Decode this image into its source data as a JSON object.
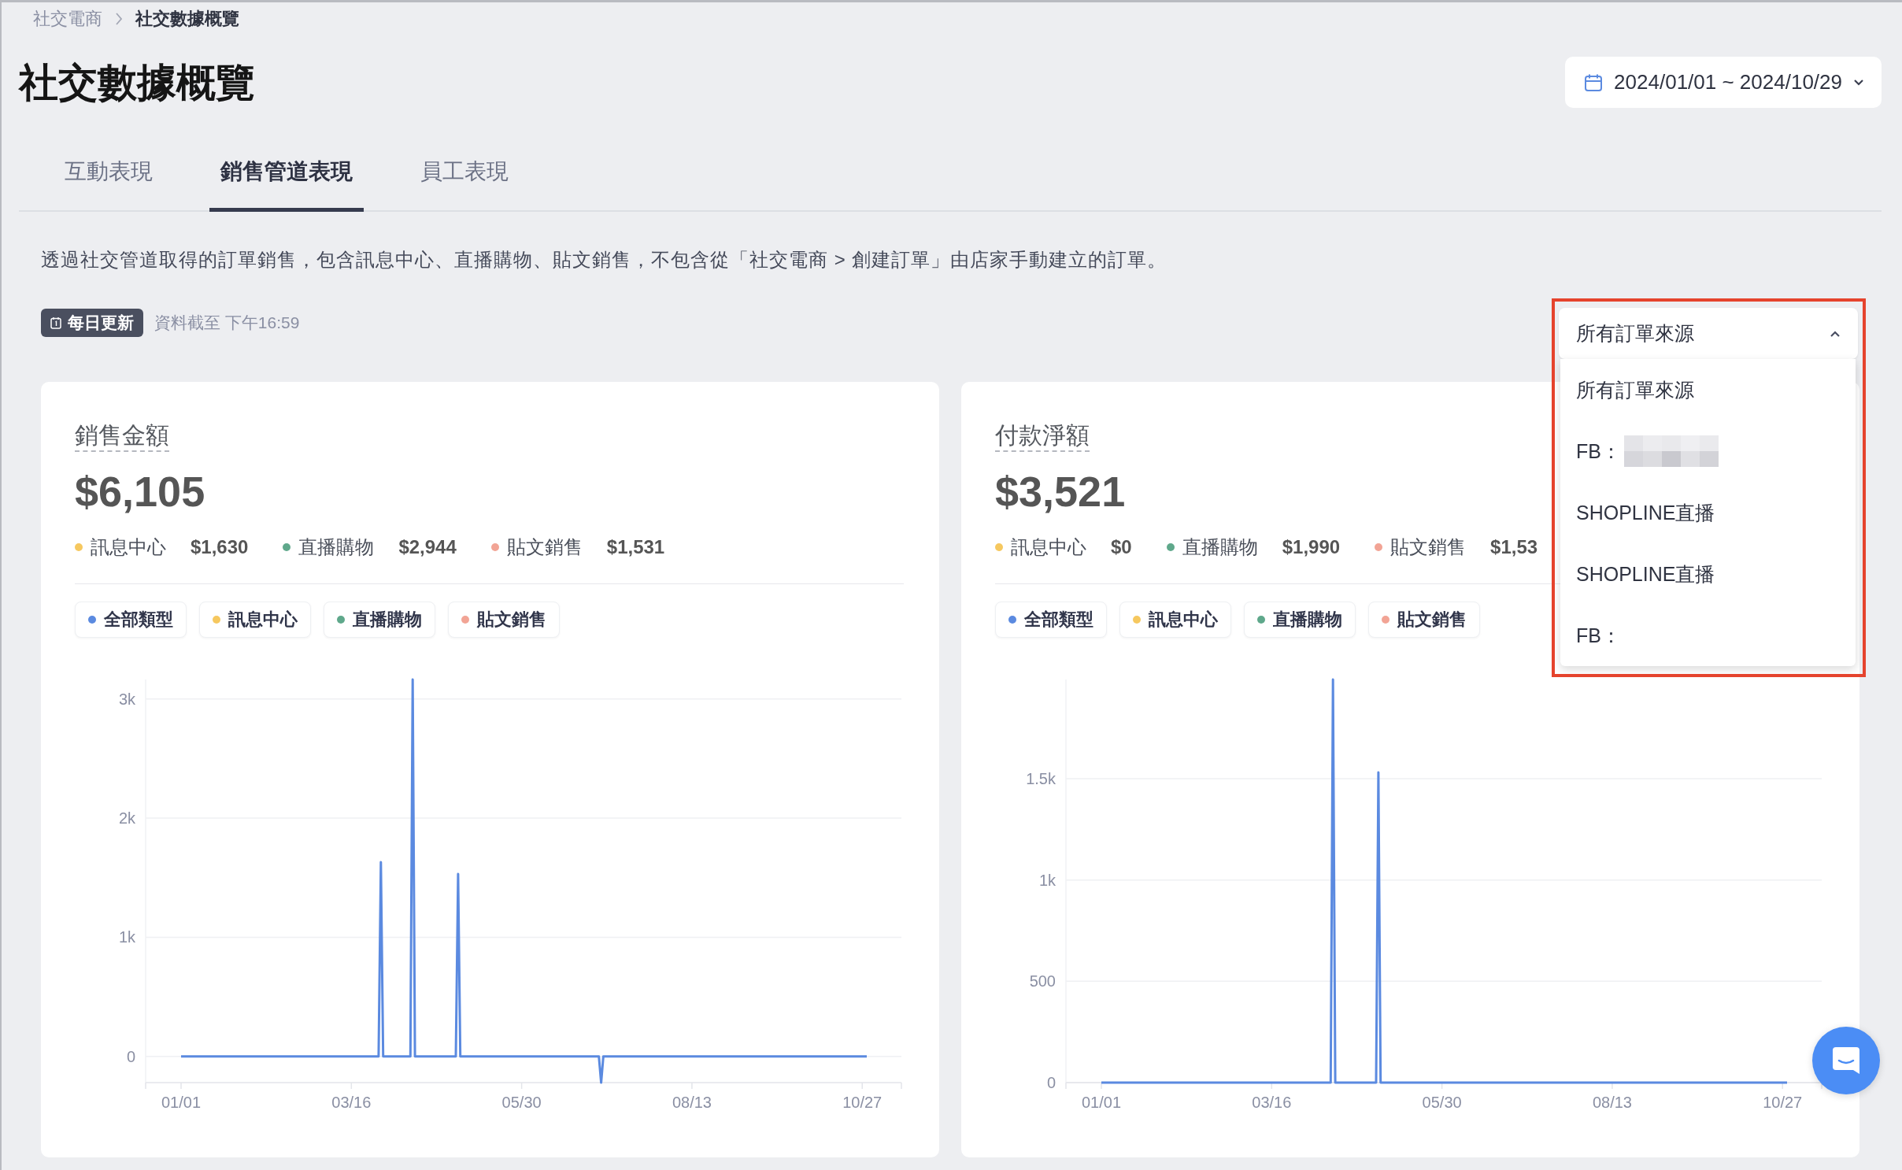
{
  "breadcrumb": [
    {
      "label": "社交電商",
      "current": false
    },
    {
      "label": "社交數據概覽",
      "current": true
    }
  ],
  "title": "社交數據概覽",
  "date_range": {
    "value": "2024/01/01 ~ 2024/10/29"
  },
  "tabs": [
    {
      "label": "互動表現",
      "selected": false
    },
    {
      "label": "銷售管道表現",
      "selected": true
    },
    {
      "label": "員工表現",
      "selected": false
    }
  ],
  "description": "透過社交管道取得的訂單銷售，包含訊息中心、直播購物、貼文銷售，不包含從「社交電商 > 創建訂單」由店家手動建立的訂單。",
  "update_badge": "每日更新",
  "updated_at": "資料截至 下午16:59",
  "source_filter": {
    "value": "所有訂單來源",
    "expanded": true,
    "highlighted": true,
    "options": [
      {
        "label": "所有訂單來源",
        "redacted": false
      },
      {
        "label": "FB：",
        "redacted": true
      },
      {
        "label": "SHOPLINE直播",
        "redacted": false
      },
      {
        "label": "SHOPLINE直播",
        "redacted": false
      },
      {
        "label": "FB：",
        "redacted": false
      }
    ]
  },
  "cards": [
    {
      "title": "銷售金額",
      "total": "$6,105",
      "breakdown": [
        {
          "label": "訊息中心",
          "amount": "$1,630",
          "color": "#f6c85f"
        },
        {
          "label": "直播購物",
          "amount": "$2,944",
          "color": "#5fa88b"
        },
        {
          "label": "貼文銷售",
          "amount": "$1,531",
          "color": "#f2a495"
        }
      ],
      "filters": [
        {
          "label": "全部類型",
          "color": "#5b8ae0"
        },
        {
          "label": "訊息中心",
          "color": "#f6c85f"
        },
        {
          "label": "直播購物",
          "color": "#5fa88b"
        },
        {
          "label": "貼文銷售",
          "color": "#f2a495"
        }
      ],
      "chart_data": {
        "type": "line",
        "grid": true,
        "categories": [
          "01/01",
          null,
          null,
          null,
          null,
          null,
          null,
          null,
          null,
          null,
          null,
          null,
          null,
          null,
          null,
          null,
          null,
          null,
          null,
          null,
          null,
          null,
          null,
          null,
          null,
          null,
          null,
          null,
          null,
          null,
          null,
          null,
          null,
          null,
          null,
          null,
          null,
          null,
          null,
          null,
          null,
          null,
          null,
          null,
          null,
          null,
          null,
          null,
          null,
          null,
          null,
          null,
          null,
          null,
          null,
          null,
          null,
          null,
          null,
          null,
          null,
          null,
          null,
          null,
          null,
          null,
          null,
          null,
          null,
          null,
          null,
          null,
          null,
          null,
          null,
          "03/16",
          null,
          null,
          null,
          null,
          null,
          null,
          null,
          null,
          null,
          null,
          null,
          null,
          null,
          null,
          null,
          null,
          null,
          null,
          null,
          null,
          null,
          null,
          null,
          null,
          null,
          null,
          null,
          null,
          null,
          null,
          null,
          null,
          null,
          null,
          null,
          null,
          null,
          null,
          null,
          null,
          null,
          null,
          null,
          null,
          null,
          null,
          null,
          null,
          null,
          null,
          null,
          null,
          null,
          null,
          null,
          null,
          null,
          null,
          null,
          null,
          null,
          null,
          null,
          null,
          null,
          null,
          null,
          null,
          null,
          null,
          null,
          null,
          null,
          null,
          "05/30",
          null,
          null,
          null,
          null,
          null,
          null,
          null,
          null,
          null,
          null,
          null,
          null,
          null,
          null,
          null,
          null,
          null,
          null,
          null,
          null,
          null,
          null,
          null,
          null,
          null,
          null,
          null,
          null,
          null,
          null,
          null,
          null,
          null,
          null,
          null,
          null,
          null,
          null,
          null,
          null,
          null,
          null,
          null,
          null,
          null,
          null,
          null,
          null,
          null,
          null,
          null,
          null,
          null,
          null,
          null,
          null,
          null,
          null,
          null,
          null,
          null,
          null,
          null,
          null,
          null,
          null,
          null,
          null,
          null,
          null,
          null,
          null,
          null,
          null,
          "08/13",
          null,
          null,
          null,
          null,
          null,
          null,
          null,
          null,
          null,
          null,
          null,
          null,
          null,
          null,
          null,
          null,
          null,
          null,
          null,
          null,
          null,
          null,
          null,
          null,
          null,
          null,
          null,
          null,
          null,
          null,
          null,
          null,
          null,
          null,
          null,
          null,
          null,
          null,
          null,
          null,
          null,
          null,
          null,
          null,
          null,
          null,
          null,
          null,
          null,
          null,
          null,
          null,
          null,
          null,
          null,
          null,
          null,
          null,
          null,
          null,
          null,
          null,
          null,
          null,
          null,
          null,
          null,
          null,
          null,
          null,
          null,
          null,
          null,
          null,
          "10/27",
          null,
          null
        ],
        "series": [
          {
            "color": "#5b8ae0",
            "values": [
              0,
              0,
              0,
              0,
              0,
              0,
              0,
              0,
              0,
              0,
              0,
              0,
              0,
              0,
              0,
              0,
              0,
              0,
              0,
              0,
              0,
              0,
              0,
              0,
              0,
              0,
              0,
              0,
              0,
              0,
              0,
              0,
              0,
              0,
              0,
              0,
              0,
              0,
              0,
              0,
              0,
              0,
              0,
              0,
              0,
              0,
              0,
              0,
              0,
              0,
              0,
              0,
              0,
              0,
              0,
              0,
              0,
              0,
              0,
              0,
              0,
              0,
              0,
              0,
              0,
              0,
              0,
              0,
              0,
              0,
              0,
              0,
              0,
              0,
              0,
              0,
              0,
              0,
              0,
              0,
              0,
              0,
              0,
              0,
              0,
              0,
              0,
              0,
              1630,
              0,
              0,
              0,
              0,
              0,
              0,
              0,
              0,
              0,
              0,
              0,
              0,
              0,
              3164,
              0,
              0,
              0,
              0,
              0,
              0,
              0,
              0,
              0,
              0,
              0,
              0,
              0,
              0,
              0,
              0,
              0,
              0,
              0,
              1531,
              0,
              0,
              0,
              0,
              0,
              0,
              0,
              0,
              0,
              0,
              0,
              0,
              0,
              0,
              0,
              0,
              0,
              0,
              0,
              0,
              0,
              0,
              0,
              0,
              0,
              0,
              0,
              0,
              0,
              0,
              0,
              0,
              0,
              0,
              0,
              0,
              0,
              0,
              0,
              0,
              0,
              0,
              0,
              0,
              0,
              0,
              0,
              0,
              0,
              0,
              0,
              0,
              0,
              0,
              0,
              0,
              0,
              0,
              0,
              0,
              0,
              0,
              -220,
              0,
              0,
              0,
              0,
              0,
              0,
              0,
              0,
              0,
              0,
              0,
              0,
              0,
              0,
              0,
              0,
              0,
              0,
              0,
              0,
              0,
              0,
              0,
              0,
              0,
              0,
              0,
              0,
              0,
              0,
              0,
              0,
              0,
              0,
              0,
              0,
              0,
              0,
              0,
              0,
              0,
              0,
              0,
              0,
              0,
              0,
              0,
              0,
              0,
              0,
              0,
              0,
              0,
              0,
              0,
              0,
              0,
              0,
              0,
              0,
              0,
              0,
              0,
              0,
              0,
              0,
              0,
              0,
              0,
              0,
              0,
              0,
              0,
              0,
              0,
              0,
              0,
              0,
              0,
              0,
              0,
              0,
              0,
              0,
              0,
              0,
              0,
              0,
              0,
              0,
              0,
              0,
              0,
              0,
              0,
              0,
              0,
              0,
              0,
              0,
              0,
              0,
              0,
              0,
              0,
              0,
              0,
              0,
              0,
              0,
              0,
              0,
              0,
              0,
              0,
              0,
              0
            ]
          }
        ],
        "ylim": [
          -220,
          3164
        ],
        "yticks": [
          {
            "value": 0,
            "label": "0"
          },
          {
            "value": 1000,
            "label": "1k"
          },
          {
            "value": 2000,
            "label": "2k"
          },
          {
            "value": 3000,
            "label": "3k"
          }
        ]
      }
    },
    {
      "title": "付款淨額",
      "total": "$3,521",
      "breakdown": [
        {
          "label": "訊息中心",
          "amount": "$0",
          "color": "#f6c85f"
        },
        {
          "label": "直播購物",
          "amount": "$1,990",
          "color": "#5fa88b"
        },
        {
          "label": "貼文銷售",
          "amount": "$1,53",
          "color": "#f2a495"
        }
      ],
      "filters": [
        {
          "label": "全部類型",
          "color": "#5b8ae0"
        },
        {
          "label": "訊息中心",
          "color": "#f6c85f"
        },
        {
          "label": "直播購物",
          "color": "#5fa88b"
        },
        {
          "label": "貼文銷售",
          "color": "#f2a495"
        }
      ],
      "chart_data": {
        "type": "line",
        "grid": true,
        "categories": [
          "01/01",
          null,
          null,
          null,
          null,
          null,
          null,
          null,
          null,
          null,
          null,
          null,
          null,
          null,
          null,
          null,
          null,
          null,
          null,
          null,
          null,
          null,
          null,
          null,
          null,
          null,
          null,
          null,
          null,
          null,
          null,
          null,
          null,
          null,
          null,
          null,
          null,
          null,
          null,
          null,
          null,
          null,
          null,
          null,
          null,
          null,
          null,
          null,
          null,
          null,
          null,
          null,
          null,
          null,
          null,
          null,
          null,
          null,
          null,
          null,
          null,
          null,
          null,
          null,
          null,
          null,
          null,
          null,
          null,
          null,
          null,
          null,
          null,
          null,
          null,
          "03/16",
          null,
          null,
          null,
          null,
          null,
          null,
          null,
          null,
          null,
          null,
          null,
          null,
          null,
          null,
          null,
          null,
          null,
          null,
          null,
          null,
          null,
          null,
          null,
          null,
          null,
          null,
          null,
          null,
          null,
          null,
          null,
          null,
          null,
          null,
          null,
          null,
          null,
          null,
          null,
          null,
          null,
          null,
          null,
          null,
          null,
          null,
          null,
          null,
          null,
          null,
          null,
          null,
          null,
          null,
          null,
          null,
          null,
          null,
          null,
          null,
          null,
          null,
          null,
          null,
          null,
          null,
          null,
          null,
          null,
          null,
          null,
          null,
          null,
          null,
          "05/30",
          null,
          null,
          null,
          null,
          null,
          null,
          null,
          null,
          null,
          null,
          null,
          null,
          null,
          null,
          null,
          null,
          null,
          null,
          null,
          null,
          null,
          null,
          null,
          null,
          null,
          null,
          null,
          null,
          null,
          null,
          null,
          null,
          null,
          null,
          null,
          null,
          null,
          null,
          null,
          null,
          null,
          null,
          null,
          null,
          null,
          null,
          null,
          null,
          null,
          null,
          null,
          null,
          null,
          null,
          null,
          null,
          null,
          null,
          null,
          null,
          null,
          null,
          null,
          null,
          null,
          null,
          null,
          null,
          null,
          null,
          null,
          null,
          null,
          null,
          "08/13",
          null,
          null,
          null,
          null,
          null,
          null,
          null,
          null,
          null,
          null,
          null,
          null,
          null,
          null,
          null,
          null,
          null,
          null,
          null,
          null,
          null,
          null,
          null,
          null,
          null,
          null,
          null,
          null,
          null,
          null,
          null,
          null,
          null,
          null,
          null,
          null,
          null,
          null,
          null,
          null,
          null,
          null,
          null,
          null,
          null,
          null,
          null,
          null,
          null,
          null,
          null,
          null,
          null,
          null,
          null,
          null,
          null,
          null,
          null,
          null,
          null,
          null,
          null,
          null,
          null,
          null,
          null,
          null,
          null,
          null,
          null,
          null,
          null,
          null,
          "10/27",
          null,
          null
        ],
        "series": [
          {
            "color": "#5b8ae0",
            "values": [
              0,
              0,
              0,
              0,
              0,
              0,
              0,
              0,
              0,
              0,
              0,
              0,
              0,
              0,
              0,
              0,
              0,
              0,
              0,
              0,
              0,
              0,
              0,
              0,
              0,
              0,
              0,
              0,
              0,
              0,
              0,
              0,
              0,
              0,
              0,
              0,
              0,
              0,
              0,
              0,
              0,
              0,
              0,
              0,
              0,
              0,
              0,
              0,
              0,
              0,
              0,
              0,
              0,
              0,
              0,
              0,
              0,
              0,
              0,
              0,
              0,
              0,
              0,
              0,
              0,
              0,
              0,
              0,
              0,
              0,
              0,
              0,
              0,
              0,
              0,
              0,
              0,
              0,
              0,
              0,
              0,
              0,
              0,
              0,
              0,
              0,
              0,
              0,
              0,
              0,
              0,
              0,
              0,
              0,
              0,
              0,
              0,
              0,
              0,
              0,
              0,
              0,
              1990,
              0,
              0,
              0,
              0,
              0,
              0,
              0,
              0,
              0,
              0,
              0,
              0,
              0,
              0,
              0,
              0,
              0,
              0,
              0,
              1531,
              0,
              0,
              0,
              0,
              0,
              0,
              0,
              0,
              0,
              0,
              0,
              0,
              0,
              0,
              0,
              0,
              0,
              0,
              0,
              0,
              0,
              0,
              0,
              0,
              0,
              0,
              0,
              0,
              0,
              0,
              0,
              0,
              0,
              0,
              0,
              0,
              0,
              0,
              0,
              0,
              0,
              0,
              0,
              0,
              0,
              0,
              0,
              0,
              0,
              0,
              0,
              0,
              0,
              0,
              0,
              0,
              0,
              0,
              0,
              0,
              0,
              0,
              0,
              0,
              0,
              0,
              0,
              0,
              0,
              0,
              0,
              0,
              0,
              0,
              0,
              0,
              0,
              0,
              0,
              0,
              0,
              0,
              0,
              0,
              0,
              0,
              0,
              0,
              0,
              0,
              0,
              0,
              0,
              0,
              0,
              0,
              0,
              0,
              0,
              0,
              0,
              0,
              0,
              0,
              0,
              0,
              0,
              0,
              0,
              0,
              0,
              0,
              0,
              0,
              0,
              0,
              0,
              0,
              0,
              0,
              0,
              0,
              0,
              0,
              0,
              0,
              0,
              0,
              0,
              0,
              0,
              0,
              0,
              0,
              0,
              0,
              0,
              0,
              0,
              0,
              0,
              0,
              0,
              0,
              0,
              0,
              0,
              0,
              0,
              0,
              0,
              0,
              0,
              0,
              0,
              0,
              0,
              0,
              0,
              0,
              0,
              0,
              0,
              0,
              0,
              0,
              0,
              0,
              0,
              0,
              0,
              0,
              0,
              0,
              0,
              0,
              0,
              0,
              0,
              0
            ]
          }
        ],
        "ylim": [
          0,
          1990
        ],
        "yticks": [
          {
            "value": 0,
            "label": "0"
          },
          {
            "value": 500,
            "label": "500"
          },
          {
            "value": 1000,
            "label": "1k"
          },
          {
            "value": 1500,
            "label": "1.5k"
          }
        ]
      }
    }
  ]
}
